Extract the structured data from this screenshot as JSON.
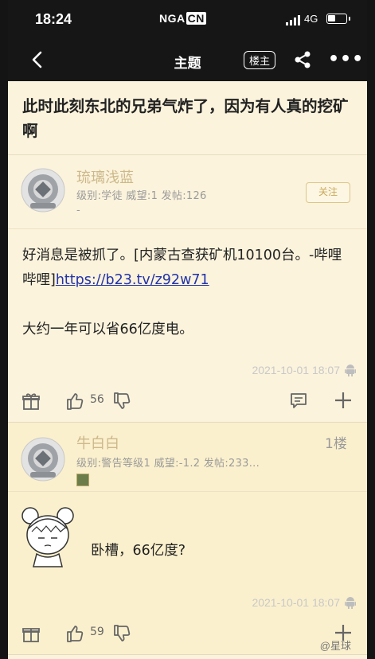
{
  "status": {
    "time": "18:24",
    "app_logo": "NGA",
    "app_logo_suffix": "CN",
    "network": "4G"
  },
  "nav": {
    "title": "主题",
    "op_button": "楼主"
  },
  "topic": {
    "title": "此时此刻东北的兄弟气炸了，因为有人真的挖矿啊"
  },
  "posts": [
    {
      "author": "琉璃浅蓝",
      "meta": "级别:学徒   威望:1   发帖:126",
      "sub": "-",
      "follow_label": "关注",
      "content_line1": "好消息是被抓了。[内蒙古查获矿机10100台。-哔哩哔哩]",
      "link": "https://b23.tv/z92w71",
      "content_line2": "大约一年可以省66亿度电。",
      "timestamp": "2021-10-01 18:07",
      "likes": "56"
    },
    {
      "author": "牛白白",
      "floor": "1楼",
      "meta": "级别:警告等级1   威望:-1.2   发帖:233...",
      "content": "卧槽，66亿度?",
      "timestamp": "2021-10-01 18:07",
      "likes": "59"
    }
  ],
  "watermark": "@星球"
}
